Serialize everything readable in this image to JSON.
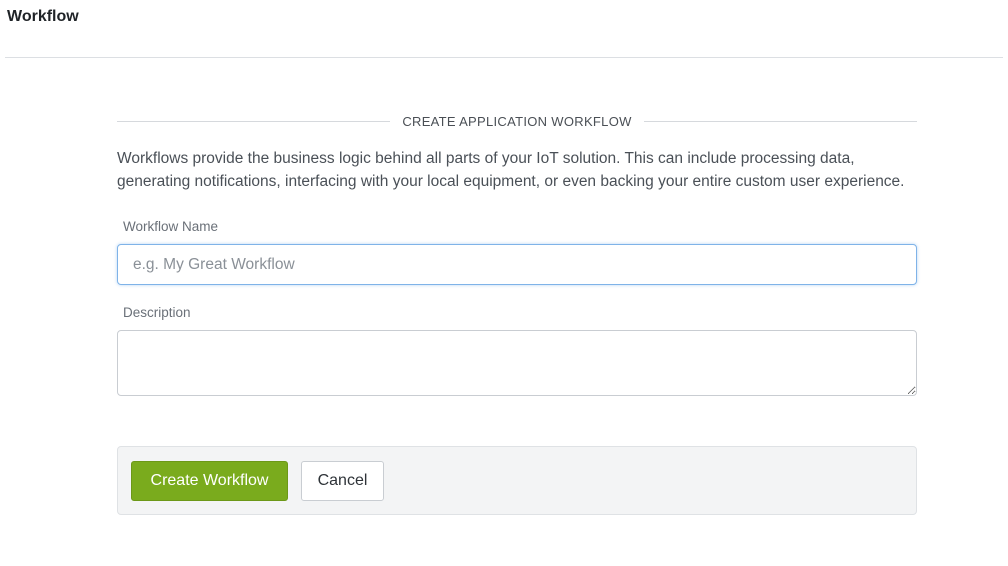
{
  "header": {
    "title": "Workflow"
  },
  "form": {
    "section_title": "CREATE APPLICATION WORKFLOW",
    "intro": "Workflows provide the business logic behind all parts of your IoT solution. This can include processing data, generating notifications, interfacing with your local equipment, or even backing your entire custom user experience.",
    "name_label": "Workflow Name",
    "name_placeholder": "e.g. My Great Workflow",
    "name_value": "",
    "description_label": "Description",
    "description_value": ""
  },
  "actions": {
    "create_label": "Create Workflow",
    "cancel_label": "Cancel"
  },
  "colors": {
    "primary": "#7aab1d",
    "focus": "#7fb3e8"
  }
}
